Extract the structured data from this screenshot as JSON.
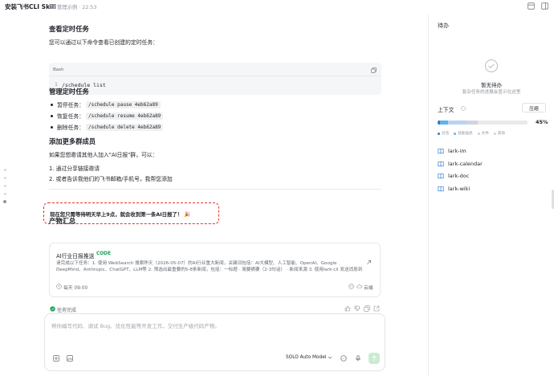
{
  "app": {
    "title": "安装飞书CLI Skill",
    "breadcrumb": "管理示例 · 22:53",
    "icons": [
      "folder-icon",
      "layout-icon",
      "panel-icon"
    ]
  },
  "content": {
    "section_view": {
      "title": "查看定时任务",
      "intro": "您可以通过以下命令查看已创建的定时任务：",
      "code": {
        "lang": "Bash",
        "line_no": "1",
        "text": "/schedule list"
      }
    },
    "section_manage": {
      "title": "管理定时任务",
      "items": [
        {
          "label": "暂停任务：",
          "code": "/schedule pause 4eb62a89"
        },
        {
          "label": "恢复任务：",
          "code": "/schedule resume 4eb62a89"
        },
        {
          "label": "删除任务：",
          "code": "/schedule delete 4eb62a89"
        }
      ]
    },
    "section_add": {
      "title": "添加更多群成员",
      "intro": "如果您想邀请其他人加入\"AI日报\"群，可以：",
      "steps": [
        "1. 通过分享链接邀请",
        "2. 或者告诉我他们的飞书邮箱/手机号，我帮您添加"
      ]
    },
    "highlight": "现在您只需等待明天早上9点，就会收到第一条AI日报了！ 🎉",
    "section_output": {
      "title": "产物汇总",
      "card": {
        "title": "AI行业日报推送",
        "tag": "CODE",
        "desc": "请完成以下任务：1. 使用 WebSearch 搜索昨天（2026-05-07）的AI行业重大新闻，关键词包括：AI大模型、人工智能、OpenAI、Google DeepMind、Anthropic、ChatGPT、LLM等 2. 筛选出最重要的5-8条新闻，包括：一标题 · 简要摘要（2-3句话） · 新闻来源 3. 使用lark-cli 发送消息到",
        "schedule": "每天 09:00",
        "cloud": "云端"
      }
    },
    "status": "任务完成"
  },
  "composer": {
    "placeholder": "帮你编写代码、调试 Bug、优化性能等开发工作，交付生产级代码产物。",
    "model": "SOLO Auto Model",
    "send_color": "#c8ecd3"
  },
  "sidebar": {
    "todo_title": "待办",
    "todo_empty": "暂无待办",
    "todo_hint": "复杂任务的进展会显示在这里",
    "context_title": "上下文",
    "compress_label": "压缩",
    "context_percent": "45%",
    "context_fill": 0.45,
    "segments": [
      {
        "label": "对话",
        "color": "#2f7dcc",
        "value": 0.03
      },
      {
        "label": "技能描述",
        "color": "#5db4ee",
        "value": 0.09
      },
      {
        "label": "文件",
        "color": "#b9d4f0",
        "value": 0.21
      },
      {
        "label": "其他",
        "color": "#d1d5db",
        "value": 0.12
      }
    ],
    "skills": [
      "lark-im",
      "lark-calendar",
      "lark-doc",
      "lark-wiki"
    ]
  }
}
